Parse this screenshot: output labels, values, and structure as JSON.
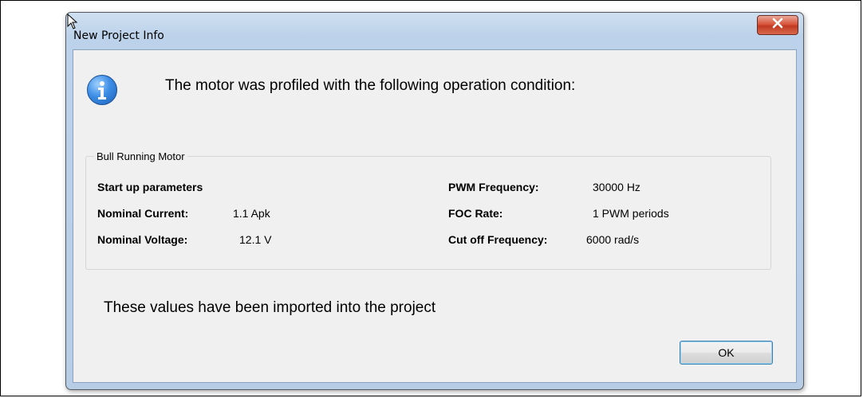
{
  "window": {
    "title": "New Project Info",
    "close_glyph": "X"
  },
  "dialog": {
    "icon": "info-icon",
    "message": "The motor was profiled with the following operation condition:",
    "group_title": "Bull Running Motor",
    "startup_header": "Start up parameters",
    "params_left": [
      {
        "label": "Nominal Current:",
        "value": "1.1 Apk"
      },
      {
        "label": "Nominal Voltage:",
        "value": "12.1 V"
      }
    ],
    "params_right": [
      {
        "label": "PWM Frequency:",
        "value": "30000 Hz"
      },
      {
        "label": "FOC Rate:",
        "value": "1 PWM periods"
      },
      {
        "label": "Cut off Frequency:",
        "value": "6000 rad/s"
      }
    ],
    "footer": "These values have been imported into the project",
    "ok_label": "OK"
  },
  "colors": {
    "window_frame": "#bcd2ea",
    "client_bg": "#f0f0f0",
    "close_button": "#c13a22",
    "info_icon": "#3d8ee6"
  }
}
